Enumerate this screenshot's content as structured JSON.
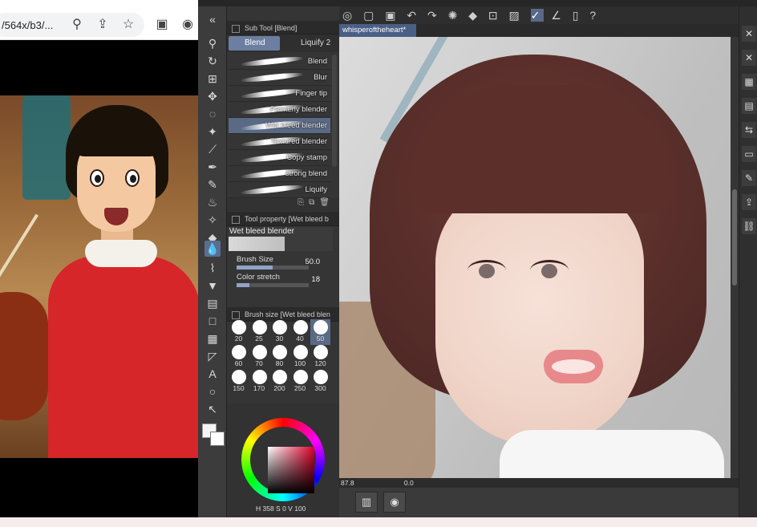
{
  "browser": {
    "url_fragment": "/564x/b3/...",
    "icons": [
      "zoom-icon",
      "share-icon",
      "bookmark-star-icon",
      "side-panel-icon",
      "extension-icon"
    ]
  },
  "subtool": {
    "panel_title": "Sub Tool [Blend]",
    "tabs": [
      {
        "label": "Blend",
        "active": true
      },
      {
        "label": "Liquify 2",
        "active": false
      }
    ],
    "brushes": [
      {
        "label": "Blend",
        "selected": false
      },
      {
        "label": "Blur",
        "selected": false
      },
      {
        "label": "Finger tip",
        "selected": false
      },
      {
        "label": "Painterly blender",
        "selected": false
      },
      {
        "label": "Wet bleed blender",
        "selected": true
      },
      {
        "label": "Textured blender",
        "selected": false
      },
      {
        "label": "Copy stamp",
        "selected": false
      },
      {
        "label": "strong blend",
        "selected": false
      },
      {
        "label": "Liquify",
        "selected": false
      }
    ]
  },
  "tool_property": {
    "panel_title": "Tool property [Wet bleed b",
    "brush_name": "Wet bleed blender",
    "brush_size_label": "Brush Size",
    "brush_size_value": "50.0",
    "brush_size_fraction": 0.5,
    "color_stretch_label": "Color stretch",
    "color_stretch_value": "18",
    "color_stretch_fraction": 0.18
  },
  "brush_size_panel": {
    "panel_title": "Brush size [Wet bleed blen",
    "sizes": [
      "20",
      "25",
      "30",
      "40",
      "50",
      "60",
      "70",
      "80",
      "100",
      "120",
      "150",
      "170",
      "200",
      "250",
      "300"
    ],
    "selected": "50"
  },
  "color_wheel": {
    "readout": "H 358  S 0  V 100",
    "hue_color": "#e0002a"
  },
  "canvas": {
    "tab_title": "whisperoftheheart*",
    "zoom": "87.8",
    "angle": "0.0"
  },
  "colors": {
    "accent": "#5b6e8f",
    "panel_bg": "#323232"
  }
}
